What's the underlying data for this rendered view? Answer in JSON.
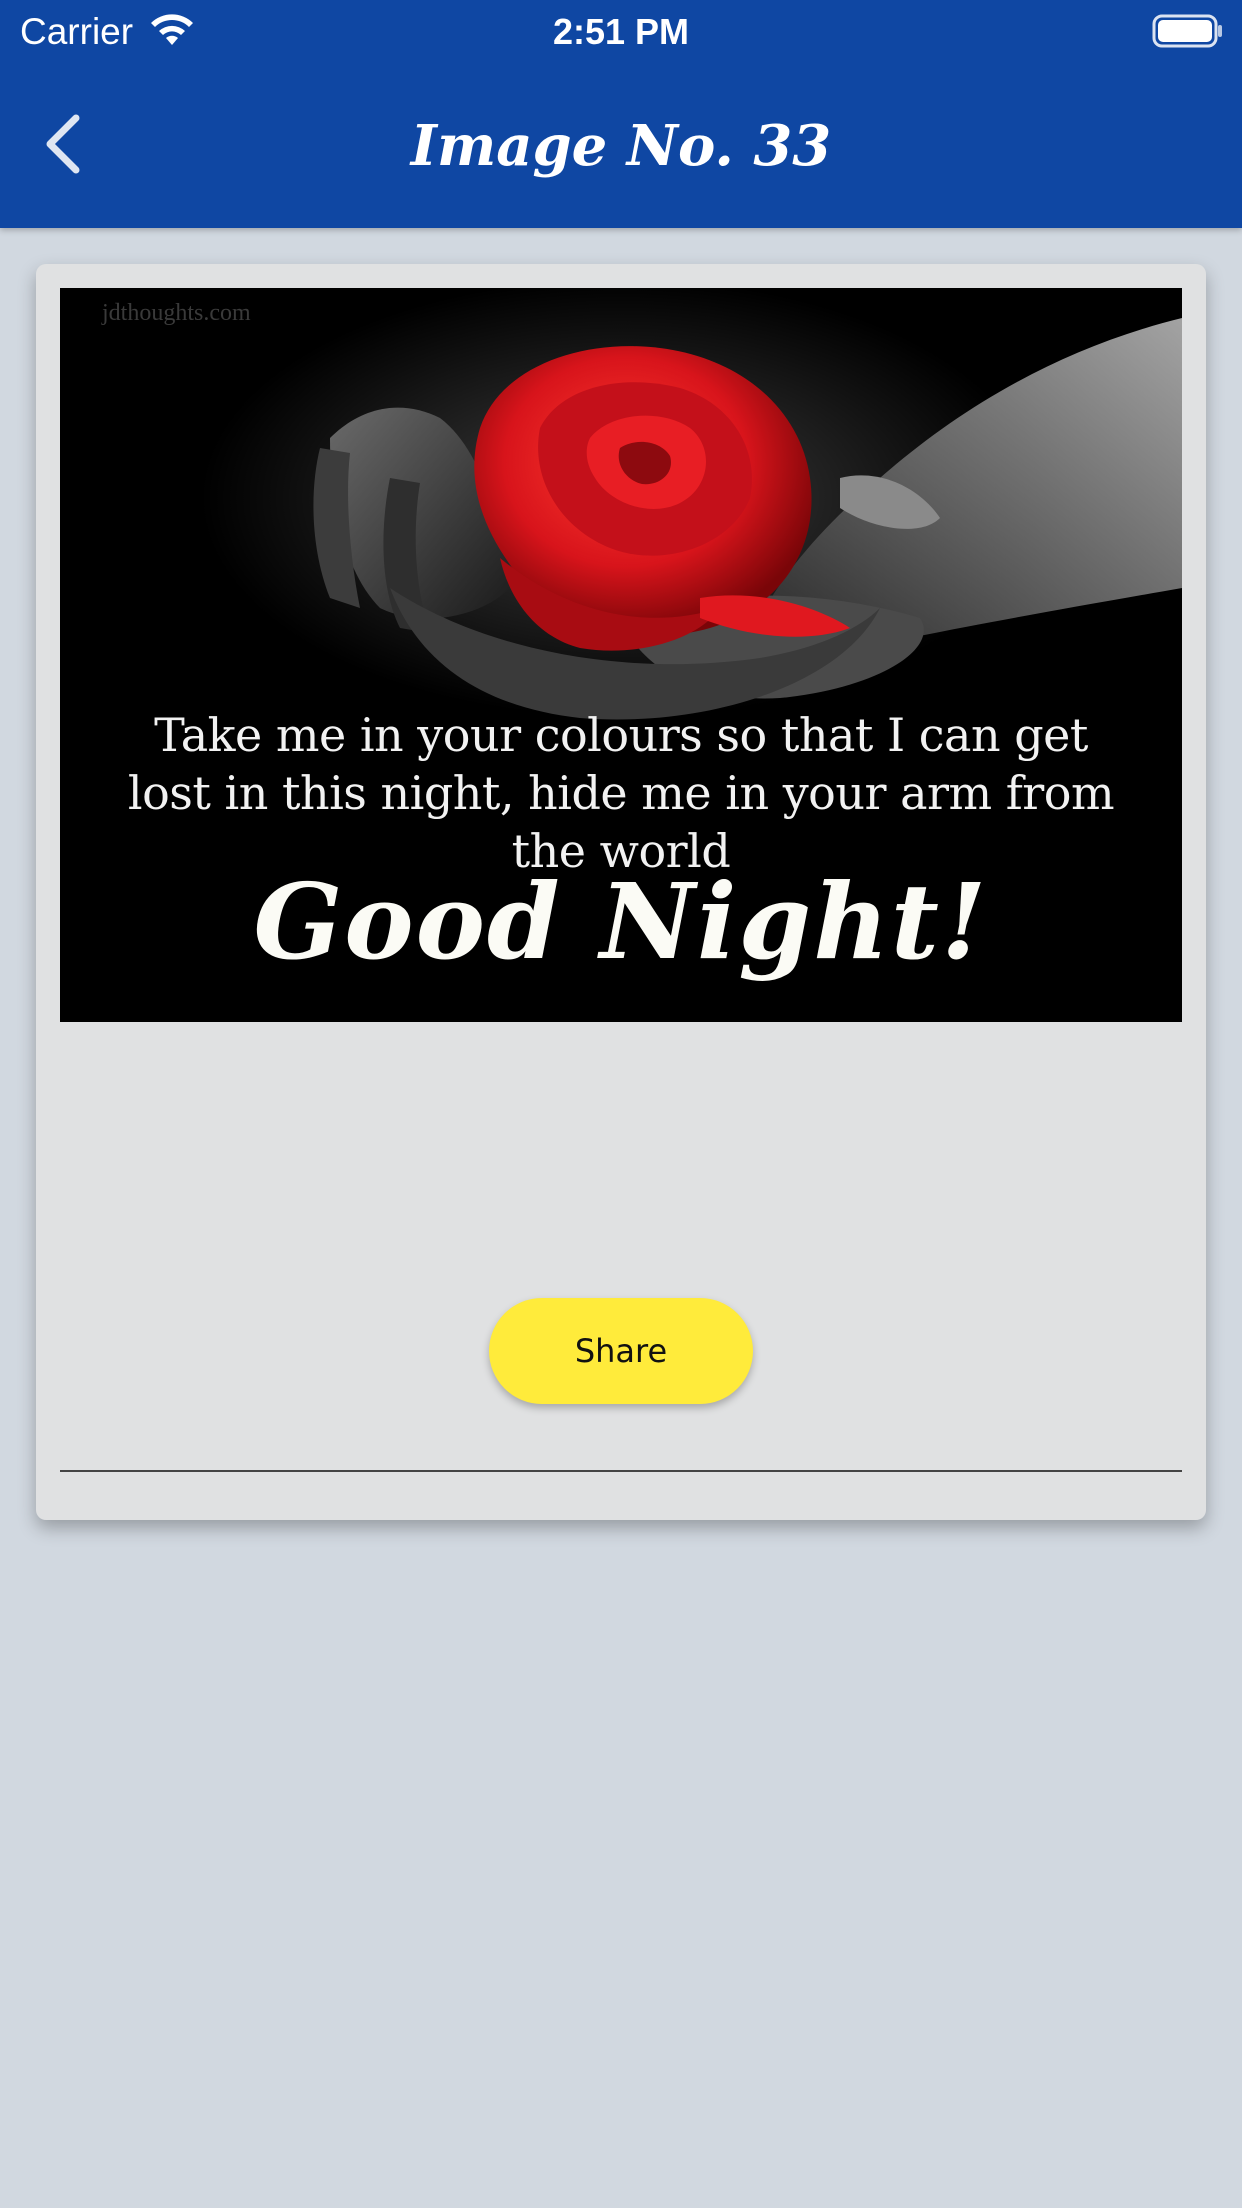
{
  "status_bar": {
    "carrier": "Carrier",
    "time": "2:51 PM",
    "wifi_icon": "wifi-icon",
    "battery_icon": "battery-icon"
  },
  "nav": {
    "back_icon": "chevron-left-icon",
    "title": "Image No. 33"
  },
  "card": {
    "image": {
      "watermark": "jdthoughts.com",
      "quote": "Take me in your colours so that I can get lost in this night, hide me in your arm from the world",
      "greeting": "Good Night!"
    },
    "share_label": "Share"
  },
  "colors": {
    "app_bar": "#0f47a3",
    "background": "#d1d8e0",
    "card": "#e0e1e2",
    "share_button": "#ffeb3b",
    "rose": "#d8141b"
  }
}
